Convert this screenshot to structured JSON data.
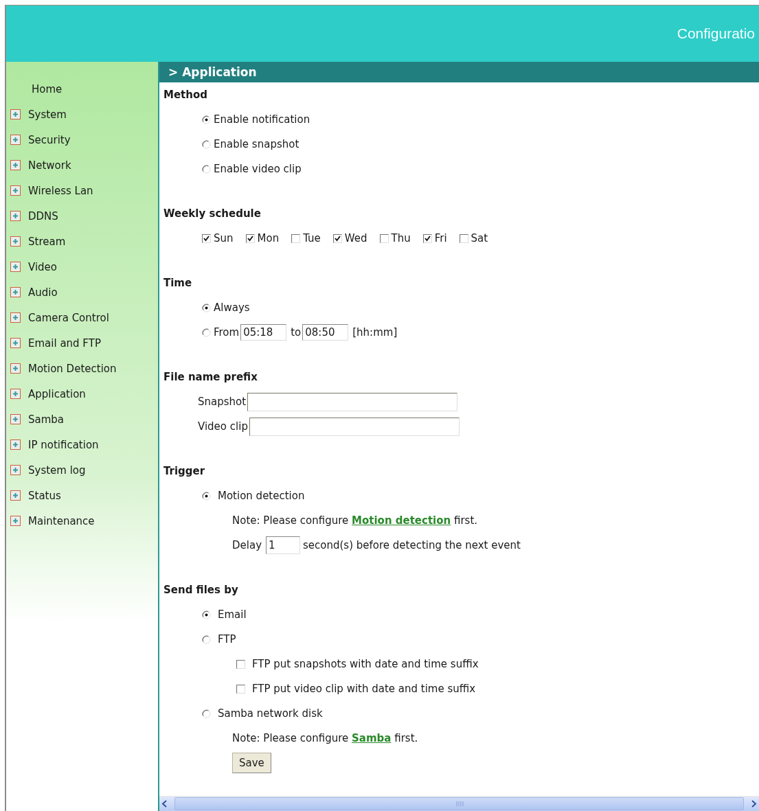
{
  "header": {
    "title": "Configuratio"
  },
  "sidebar": {
    "items": [
      {
        "label": "Home",
        "expandable": false
      },
      {
        "label": "System",
        "expandable": true
      },
      {
        "label": "Security",
        "expandable": true
      },
      {
        "label": "Network",
        "expandable": true
      },
      {
        "label": "Wireless Lan",
        "expandable": true
      },
      {
        "label": "DDNS",
        "expandable": true
      },
      {
        "label": "Stream",
        "expandable": true
      },
      {
        "label": "Video",
        "expandable": true
      },
      {
        "label": "Audio",
        "expandable": true
      },
      {
        "label": "Camera Control",
        "expandable": true
      },
      {
        "label": "Email and FTP",
        "expandable": true
      },
      {
        "label": "Motion Detection",
        "expandable": true
      },
      {
        "label": "Application",
        "expandable": true
      },
      {
        "label": "Samba",
        "expandable": true
      },
      {
        "label": "IP notification",
        "expandable": true
      },
      {
        "label": "System log",
        "expandable": true
      },
      {
        "label": "Status",
        "expandable": true
      },
      {
        "label": "Maintenance",
        "expandable": true
      }
    ]
  },
  "page_title": "> Application",
  "sections": [
    {
      "heading": "Method",
      "rows": [
        {
          "kind": "radio",
          "label": "Enable notification",
          "selected": true
        },
        {
          "kind": "radio",
          "label": "Enable snapshot",
          "selected": false
        },
        {
          "kind": "radio",
          "label": "Enable video clip",
          "selected": false
        }
      ]
    },
    {
      "heading": "Weekly schedule",
      "rows": [
        {
          "kind": "days",
          "days": [
            {
              "label": "Sun",
              "checked": true
            },
            {
              "label": "Mon",
              "checked": true
            },
            {
              "label": "Tue",
              "checked": false
            },
            {
              "label": "Wed",
              "checked": true
            },
            {
              "label": "Thu",
              "checked": false
            },
            {
              "label": "Fri",
              "checked": true
            },
            {
              "label": "Sat",
              "checked": false
            }
          ]
        }
      ]
    },
    {
      "heading": "Time",
      "rows": [
        {
          "kind": "radio",
          "label": "Always",
          "selected": true
        },
        {
          "kind": "range",
          "label": "From",
          "selected": false,
          "from": "05:18",
          "joiner": "to",
          "to": "08:50",
          "hint": "[hh:mm]"
        }
      ]
    },
    {
      "heading": "File name prefix",
      "rows": [
        {
          "kind": "field",
          "label": "Snapshot"
        },
        {
          "kind": "field",
          "label": "Video clip"
        }
      ]
    },
    {
      "heading": "Trigger",
      "rows": [
        {
          "kind": "radio-wide",
          "label": "Motion detection",
          "selected": true
        },
        {
          "kind": "note",
          "text": "Note: Please configure",
          "link": "Motion detection",
          "after": "first."
        },
        {
          "kind": "delay",
          "label": "Delay",
          "value": "1",
          "suffix": "second(s) before detecting the next event"
        }
      ]
    },
    {
      "heading": "Send files by",
      "rows": [
        {
          "kind": "radio-wide",
          "label": "Email",
          "selected": true
        },
        {
          "kind": "radio-wide",
          "label": "FTP",
          "selected": false
        },
        {
          "kind": "checkbox",
          "label": "FTP put snapshots with date and time suffix",
          "checked": false
        },
        {
          "kind": "checkbox",
          "label": "FTP put video clip with date and time suffix",
          "checked": false
        },
        {
          "kind": "radio-wide",
          "label": "Samba network disk",
          "selected": false
        },
        {
          "kind": "note",
          "text": "Note: Please configure",
          "link": "Samba",
          "after": "first."
        },
        {
          "kind": "button",
          "label": "Save"
        }
      ]
    }
  ]
}
